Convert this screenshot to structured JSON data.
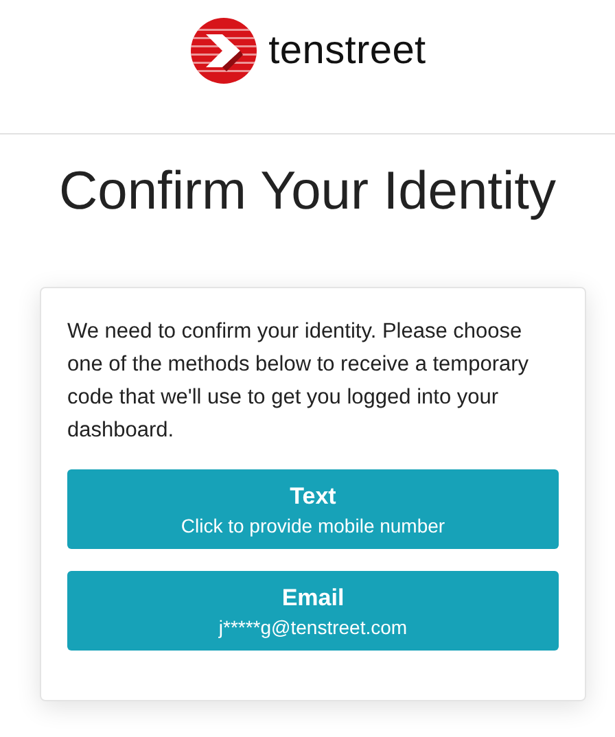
{
  "logo": {
    "text": "tenstreet"
  },
  "title": "Confirm Your Identity",
  "card": {
    "message": "We need to confirm your identity. Please choose one of the methods below to receive a temporary code that we'll use to get you logged into your dashboard.",
    "methods": [
      {
        "label": "Text",
        "detail": "Click to provide mobile number"
      },
      {
        "label": "Email",
        "detail": "j*****g@tenstreet.com"
      }
    ]
  }
}
